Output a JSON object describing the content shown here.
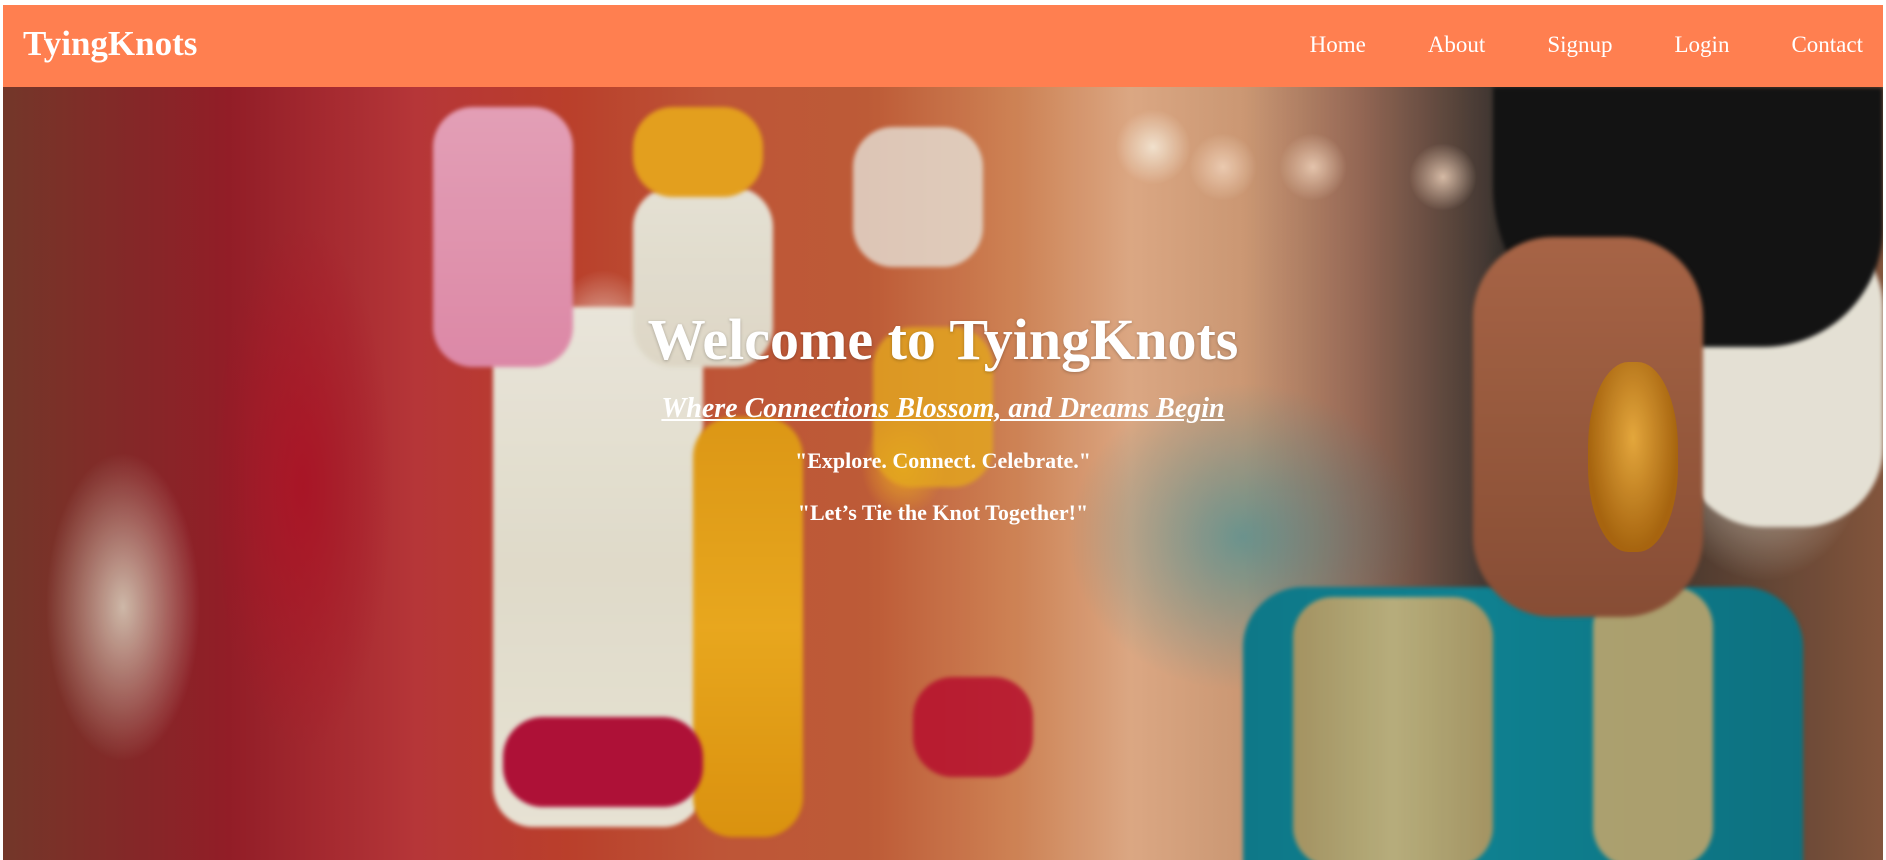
{
  "navbar": {
    "brand": "TyingKnots",
    "links": [
      {
        "label": "Home"
      },
      {
        "label": "About"
      },
      {
        "label": "Signup"
      },
      {
        "label": "Login"
      },
      {
        "label": "Contact"
      }
    ],
    "background_color": "#ff7f50"
  },
  "hero": {
    "title": "Welcome to TyingKnots",
    "tagline": "Where Connections Blossom, and Dreams Begin",
    "line1": "\"Explore. Connect. Celebrate.\"",
    "line2": "\"Let’s Tie the Knot Together!\"",
    "image_subject": "wedding-flower-garlands-and-bride-photo"
  }
}
